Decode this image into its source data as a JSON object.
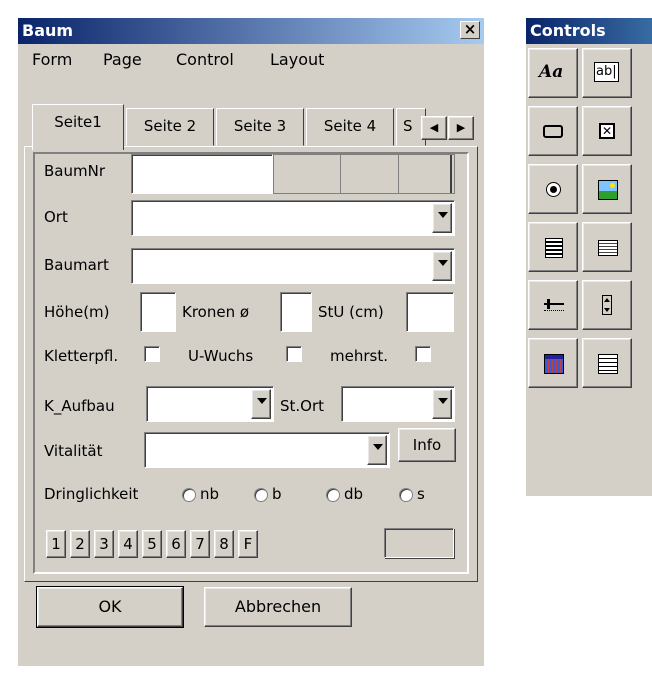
{
  "baum_window": {
    "title": "Baum",
    "close_glyph": "×",
    "menu": [
      "Form",
      "Page",
      "Control",
      "Layout"
    ],
    "tabs": [
      "Seite1",
      "Seite 2",
      "Seite 3",
      "Seite 4",
      "S"
    ],
    "tab_scroll_left": "◀",
    "tab_scroll_right": "▶",
    "fields": {
      "baumnr_label": "BaumNr",
      "ort_label": "Ort",
      "baumart_label": "Baumart",
      "hoehe_label": "Höhe(m)",
      "kronen_label": "Kronen ø",
      "stu_label": "StU (cm)",
      "kletter_label": "Kletterpfl.",
      "uwuchs_label": "U-Wuchs",
      "mehrst_label": "mehrst.",
      "kaufbau_label": "K_Aufbau",
      "stort_label": "St.Ort",
      "vitalitaet_label": "Vitalität",
      "info_button": "Info",
      "dringlichkeit_label": "Dringlichkeit",
      "radio_options": [
        "nb",
        "b",
        "db",
        "s"
      ]
    },
    "number_buttons": [
      "1",
      "2",
      "3",
      "4",
      "5",
      "6",
      "7",
      "8",
      "F"
    ],
    "ok_button": "OK",
    "cancel_button": "Abbrechen"
  },
  "controls_window": {
    "title": "Controls",
    "label_tool_text": "Aa",
    "textbox_tool_text": "ab|",
    "tools": [
      "label-tool",
      "textbox-tool",
      "button-tool",
      "checkbox-tool",
      "radio-tool",
      "image-tool",
      "listbox-tool",
      "combobox-tool",
      "slider-tool",
      "spinner-tool",
      "calendar-tool",
      "grid-tool"
    ]
  }
}
